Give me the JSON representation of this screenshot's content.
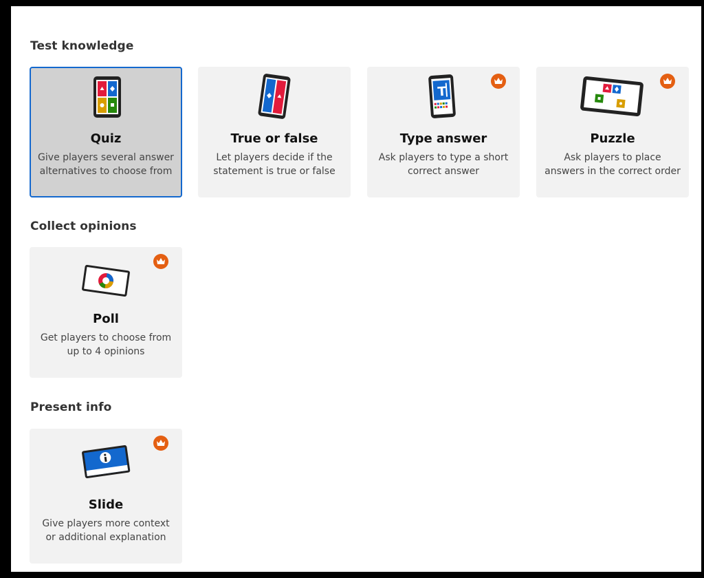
{
  "sections": {
    "test_knowledge": {
      "title": "Test knowledge",
      "cards": [
        {
          "title": "Quiz",
          "description": "Give players several answer alternatives to choose from",
          "selected": true,
          "premium": false
        },
        {
          "title": "True or false",
          "description": "Let players decide if the statement is true or false",
          "selected": false,
          "premium": false
        },
        {
          "title": "Type answer",
          "description": "Ask players to type a short correct answer",
          "selected": false,
          "premium": true
        },
        {
          "title": "Puzzle",
          "description": "Ask players to place answers in the correct order",
          "selected": false,
          "premium": true
        }
      ]
    },
    "collect_opinions": {
      "title": "Collect opinions",
      "cards": [
        {
          "title": "Poll",
          "description": "Get players to choose from up to 4 opinions",
          "selected": false,
          "premium": true
        }
      ]
    },
    "present_info": {
      "title": "Present info",
      "cards": [
        {
          "title": "Slide",
          "description": "Give players more context or additional explanation",
          "selected": false,
          "premium": true
        }
      ]
    }
  },
  "colors": {
    "selected_border": "#1368ce",
    "premium_badge": "#e45f12",
    "red": "#e21b3c",
    "blue": "#1368ce",
    "yellow": "#d89e00",
    "green": "#26890c"
  }
}
